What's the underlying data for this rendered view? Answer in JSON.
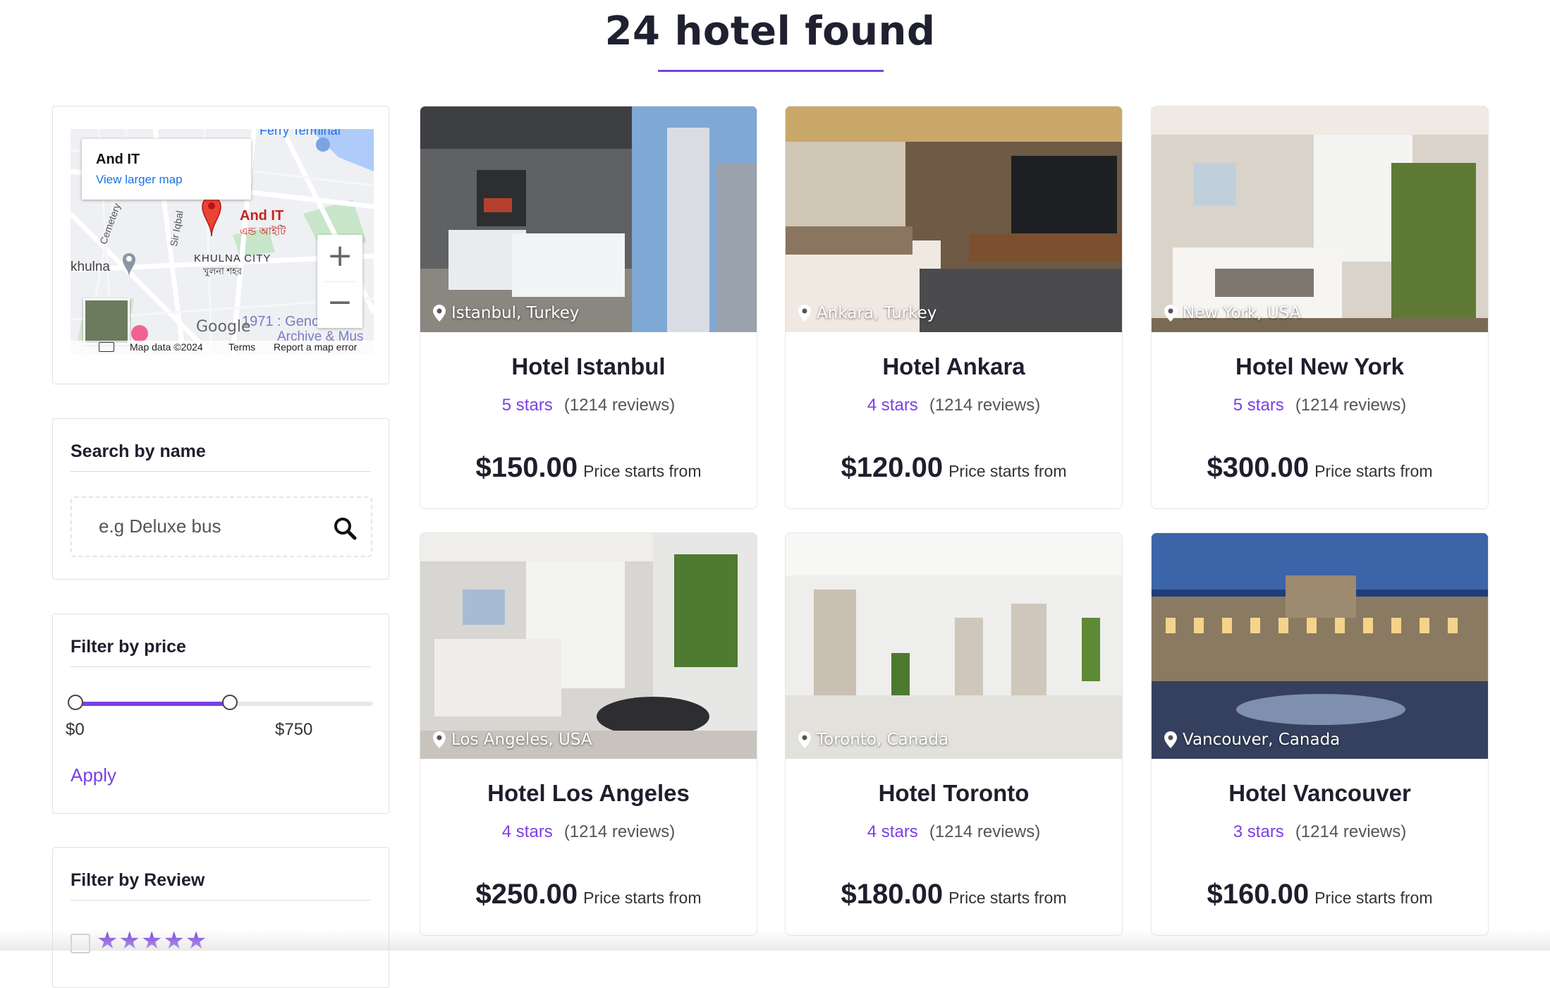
{
  "header": {
    "title": "24 hotel found"
  },
  "sidebar": {
    "map": {
      "place_name": "And IT",
      "larger_map_link": "View larger map",
      "pin_label": "And IT",
      "pin_label_bn": "এন্ড আইটি",
      "area_label": "KHULNA CITY",
      "area_label_bn": "খুলনা শহর",
      "left_label": "khulna",
      "road_label_1": "Cemetery",
      "road_label_2": "Sir Iqbal",
      "top_label": "Ferry Terminal",
      "bottom_label": "1971 : Geno",
      "bottom_label_2": "Archive & Mus",
      "google_logo": "Google",
      "map_data": "Map data ©2024",
      "terms": "Terms",
      "report": "Report a map error"
    },
    "search": {
      "title": "Search by name",
      "placeholder": "e.g Deluxe bus"
    },
    "price_filter": {
      "title": "Filter by price",
      "min_label": "$0",
      "max_label": "$750",
      "range_fill_fraction": 0.52,
      "apply_label": "Apply"
    },
    "review_filter": {
      "title": "Filter by Review",
      "stars": "★★★★★"
    }
  },
  "hotels": [
    {
      "name": "Hotel Istanbul",
      "location": "Istanbul, Turkey",
      "stars": "5 stars",
      "reviews": "(1214 reviews)",
      "price": "$150.00",
      "price_note": "Price starts from"
    },
    {
      "name": "Hotel Ankara",
      "location": "Ankara, Turkey",
      "stars": "4 stars",
      "reviews": "(1214 reviews)",
      "price": "$120.00",
      "price_note": "Price starts from"
    },
    {
      "name": "Hotel New York",
      "location": "New York, USA",
      "stars": "5 stars",
      "reviews": "(1214 reviews)",
      "price": "$300.00",
      "price_note": "Price starts from"
    },
    {
      "name": "Hotel Los Angeles",
      "location": "Los Angeles, USA",
      "stars": "4 stars",
      "reviews": "(1214 reviews)",
      "price": "$250.00",
      "price_note": "Price starts from"
    },
    {
      "name": "Hotel Toronto",
      "location": "Toronto, Canada",
      "stars": "4 stars",
      "reviews": "(1214 reviews)",
      "price": "$180.00",
      "price_note": "Price starts from"
    },
    {
      "name": "Hotel Vancouver",
      "location": "Vancouver, Canada",
      "stars": "3 stars",
      "reviews": "(1214 reviews)",
      "price": "$160.00",
      "price_note": "Price starts from"
    }
  ],
  "colors": {
    "accent": "#7b3fe4",
    "heading": "#1e1e2d"
  }
}
